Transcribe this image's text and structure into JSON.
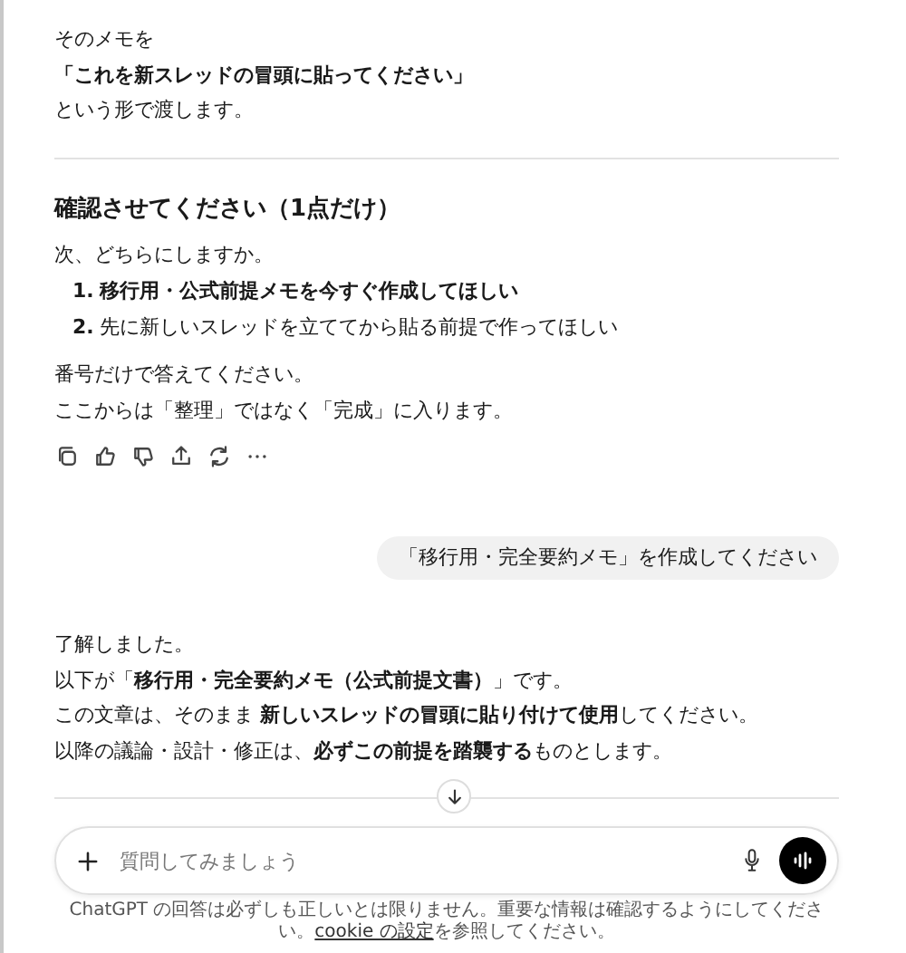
{
  "assistant_intro": [
    {
      "text": "そのメモを",
      "bold": false
    },
    {
      "text": "「これを新スレッドの冒頭に貼ってください」",
      "bold": true
    },
    {
      "text": "という形で渡します。",
      "bold": false
    }
  ],
  "question": {
    "heading": "確認させてください（1点だけ）",
    "prompt": "次、どちらにしますか。",
    "options": [
      {
        "number": "1.",
        "text": "移行用・公式前提メモを今すぐ作成してほしい",
        "bold": true
      },
      {
        "number": "2.",
        "text": "先に新しいスレッドを立ててから貼る前提で作ってほしい",
        "bold": false
      }
    ],
    "closing": [
      "番号だけで答えてください。",
      "ここからは「整理」ではなく「完成」に入ります。"
    ]
  },
  "user_message": "「移行用・完全要約メモ」を作成してください",
  "assistant_reply": [
    "了解しました。",
    "以下が「**移行用・完全要約メモ（公式前提文書）**」です。",
    "この文章は、そのまま **新しいスレッドの冒頭に貼り付けて使用**してください。",
    "以降の議論・設計・修正は、**必ずこの前提を踏襲する**ものとします。"
  ],
  "composer": {
    "placeholder": "質問してみましょう"
  },
  "footer": {
    "before": "ChatGPT の回答は必ずしも正しいとは限りません。重要な情報は確認するようにしてください。",
    "link": "cookie の設定",
    "after": "を参照してください。"
  }
}
